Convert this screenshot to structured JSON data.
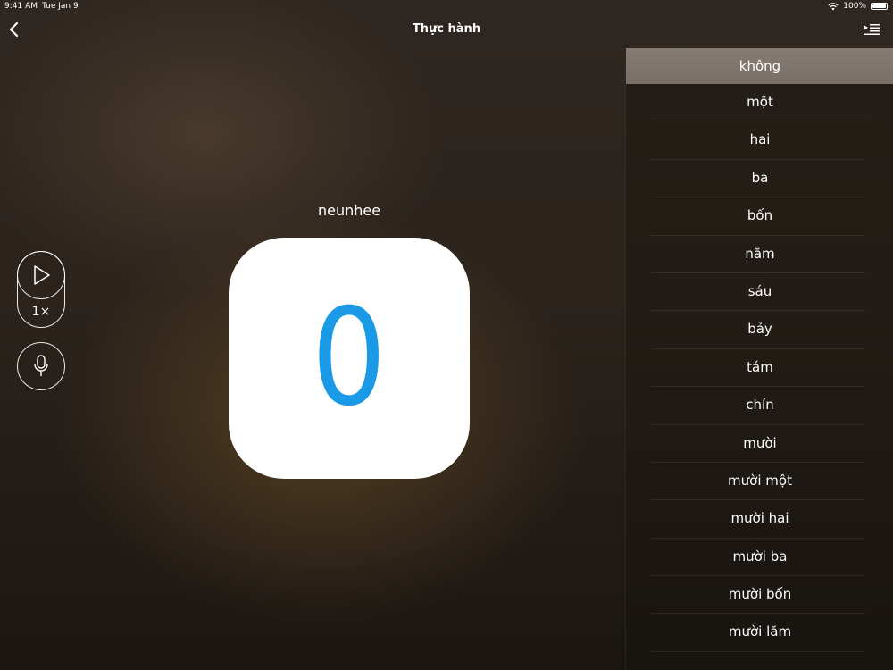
{
  "status_bar": {
    "time": "9:41 AM",
    "date": "Tue Jan 9",
    "battery": "100%"
  },
  "nav": {
    "title": "Thực hành",
    "back_icon": "chevron-left-icon",
    "list_icon": "play-list-icon"
  },
  "card": {
    "pronunciation": "neunhee",
    "digit": "0",
    "digit_color": "#1a9ae6"
  },
  "controls": {
    "speed_label": "1×",
    "play_icon": "play-icon",
    "mic_icon": "microphone-icon"
  },
  "word_list": {
    "selected_index": 0,
    "items": [
      "không",
      "một",
      "hai",
      "ba",
      "bốn",
      "năm",
      "sáu",
      "bảy",
      "tám",
      "chín",
      "mười",
      "mười một",
      "mười hai",
      "mười ba",
      "mười bốn",
      "mười lăm"
    ]
  }
}
